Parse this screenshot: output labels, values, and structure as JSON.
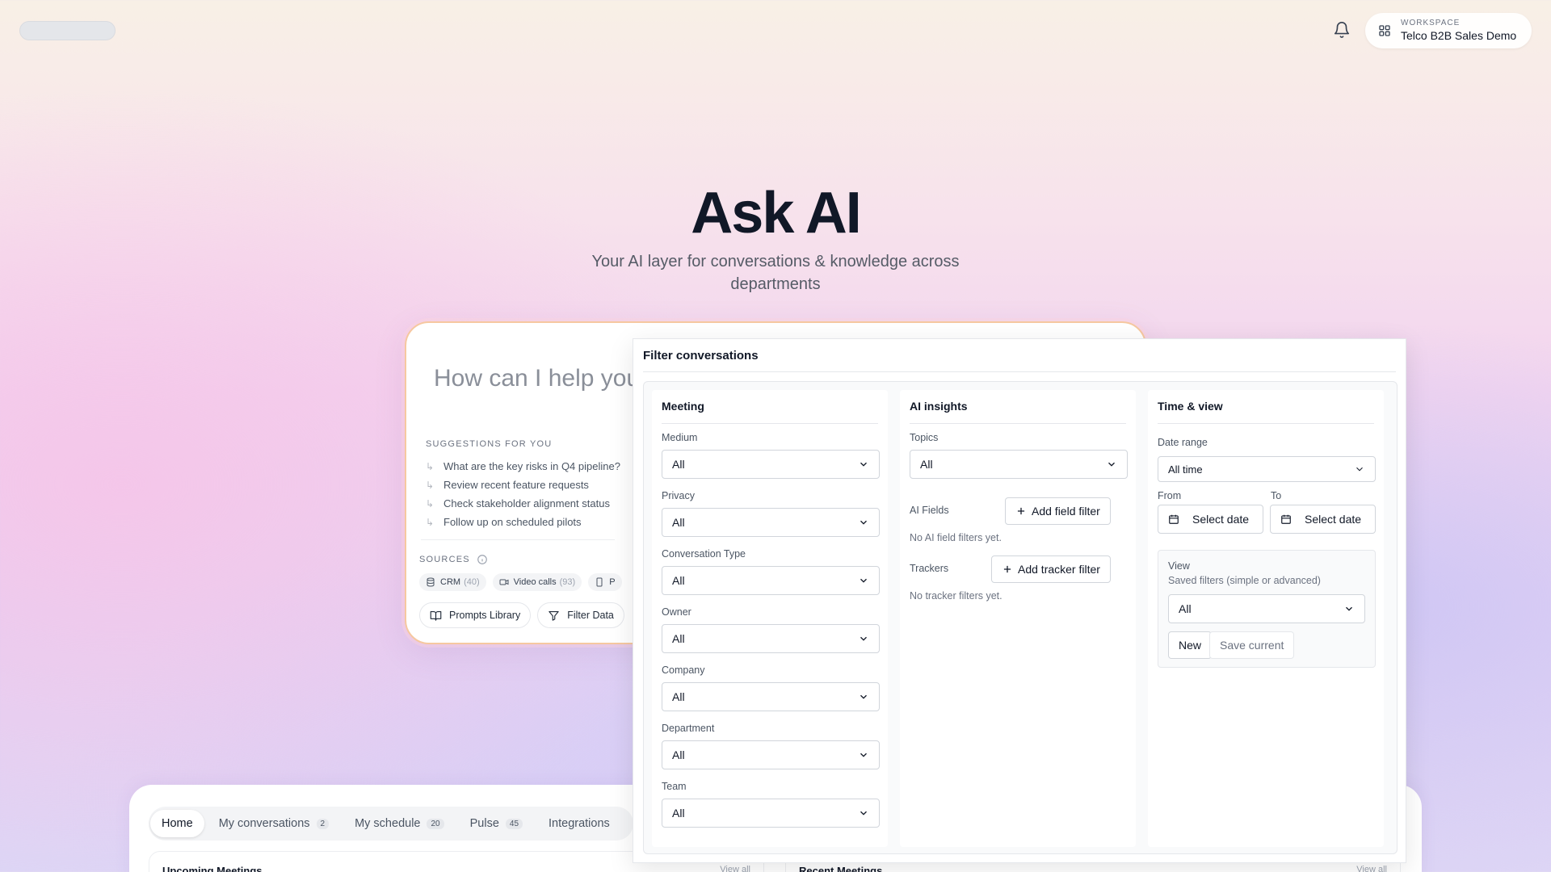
{
  "topbar": {
    "bell_icon": "bell-icon",
    "workspace": {
      "kicker": "WORKSPACE",
      "name": "Telco B2B Sales Demo",
      "icon": "grid-icon"
    }
  },
  "hero": {
    "title": "Ask AI",
    "subtitle": "Your AI layer for conversations & knowledge across departments"
  },
  "ask": {
    "placeholder": "How can I help you",
    "suggestions_heading": "SUGGESTIONS FOR YOU",
    "suggestions": [
      "What are the key risks in Q4 pipeline?",
      "Review recent feature requests",
      "Check stakeholder alignment status",
      "Follow up on scheduled pilots"
    ],
    "sources_heading": "SOURCES",
    "sources": [
      {
        "label": "CRM",
        "count": "(40)",
        "icon": "database-icon"
      },
      {
        "label": "Video calls",
        "count": "(93)",
        "icon": "video-icon"
      },
      {
        "label": "P",
        "count": "",
        "icon": "phone-icon"
      }
    ],
    "prompts_library": "Prompts Library",
    "filter_data": "Filter Data"
  },
  "bottom": {
    "tabs": [
      {
        "label": "Home",
        "badge": ""
      },
      {
        "label": "My conversations",
        "badge": "2"
      },
      {
        "label": "My schedule",
        "badge": "20"
      },
      {
        "label": "Pulse",
        "badge": "45"
      },
      {
        "label": "Integrations",
        "badge": ""
      }
    ],
    "upcoming_title": "Upcoming Meetings",
    "recent_title": "Recent Meetings",
    "view_all": "View all"
  },
  "filter": {
    "title": "Filter conversations",
    "meeting": {
      "heading": "Meeting",
      "fields": [
        {
          "label": "Medium",
          "value": "All"
        },
        {
          "label": "Privacy",
          "value": "All"
        },
        {
          "label": "Conversation Type",
          "value": "All"
        },
        {
          "label": "Owner",
          "value": "All"
        },
        {
          "label": "Company",
          "value": "All"
        },
        {
          "label": "Department",
          "value": "All"
        },
        {
          "label": "Team",
          "value": "All"
        }
      ]
    },
    "ai_insights": {
      "heading": "AI insights",
      "topics_label": "Topics",
      "topics_value": "All",
      "ai_fields_label": "AI Fields",
      "add_field_filter": "Add field filter",
      "no_ai_fields": "No AI field filters yet.",
      "trackers_label": "Trackers",
      "add_tracker_filter": "Add tracker filter",
      "no_trackers": "No tracker filters yet."
    },
    "time_view": {
      "heading": "Time & view",
      "date_range_label": "Date range",
      "date_range_value": "All time",
      "from_label": "From",
      "to_label": "To",
      "select_date": "Select date",
      "view_label": "View",
      "view_hint": "Saved filters (simple or advanced)",
      "view_value": "All",
      "new_button": "New",
      "save_current": "Save current"
    }
  }
}
